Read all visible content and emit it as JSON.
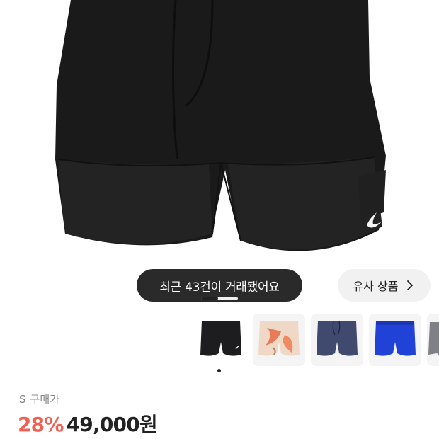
{
  "product": {
    "image_icon": "black-running-shorts-photo"
  },
  "recent_trades_label": "최근 43건이 거래됐어요",
  "similar_button_label": "유사 상품",
  "thumbnails": [
    {
      "name": "black-shorts",
      "color": "#1d1d1f"
    },
    {
      "name": "floral-shorts",
      "color": "#e8a58a"
    },
    {
      "name": "navy-shorts",
      "color": "#3f4a6e"
    },
    {
      "name": "blue-shorts",
      "color": "#2042d6"
    },
    {
      "name": "grey-shorts",
      "color": "#7f8186"
    }
  ],
  "size_label": "S",
  "buy_price_label": "구매가",
  "discount": "28%",
  "price": "49,000원",
  "colors": {
    "discount": "#ef6253",
    "pill_dark": "#2a2a2a",
    "pill_light": "#f1f1f1"
  }
}
